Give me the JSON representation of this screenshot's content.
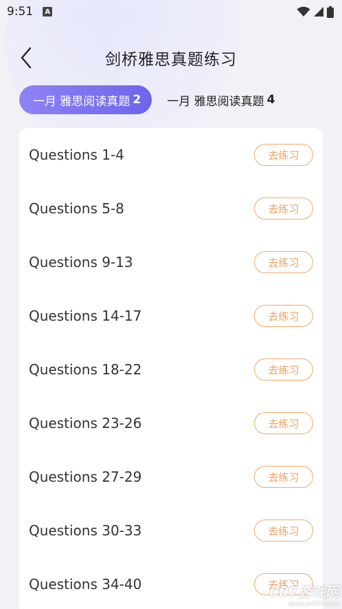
{
  "status_bar": {
    "time": "9:51",
    "notification_letter": "A"
  },
  "header": {
    "title": "剑桥雅思真题练习"
  },
  "tabs": [
    {
      "label": "一月 雅思阅读真题",
      "number": "2",
      "active": true
    },
    {
      "label": "一月 雅思阅读真题",
      "number": "4",
      "active": false
    }
  ],
  "items": [
    {
      "title": "Questions 1-4",
      "button": "去练习"
    },
    {
      "title": "Questions 5-8",
      "button": "去练习"
    },
    {
      "title": "Questions 9-13",
      "button": "去练习"
    },
    {
      "title": "Questions 14-17",
      "button": "去练习"
    },
    {
      "title": "Questions 18-22",
      "button": "去练习"
    },
    {
      "title": "Questions 23-26",
      "button": "去练习"
    },
    {
      "title": "Questions 27-29",
      "button": "去练习"
    },
    {
      "title": "Questions 30-33",
      "button": "去练习"
    },
    {
      "title": "Questions 34-40",
      "button": "去练习"
    }
  ],
  "watermark": {
    "main": "007游戏网",
    "url": "www.yx007.com"
  },
  "colors": {
    "accent_start": "#8e84f5",
    "accent_end": "#6f63ea",
    "practice": "#f0a05c"
  },
  "icons": {
    "back": "chevron-left-icon",
    "wifi": "wifi-icon",
    "signal": "signal-icon",
    "battery": "battery-icon"
  }
}
